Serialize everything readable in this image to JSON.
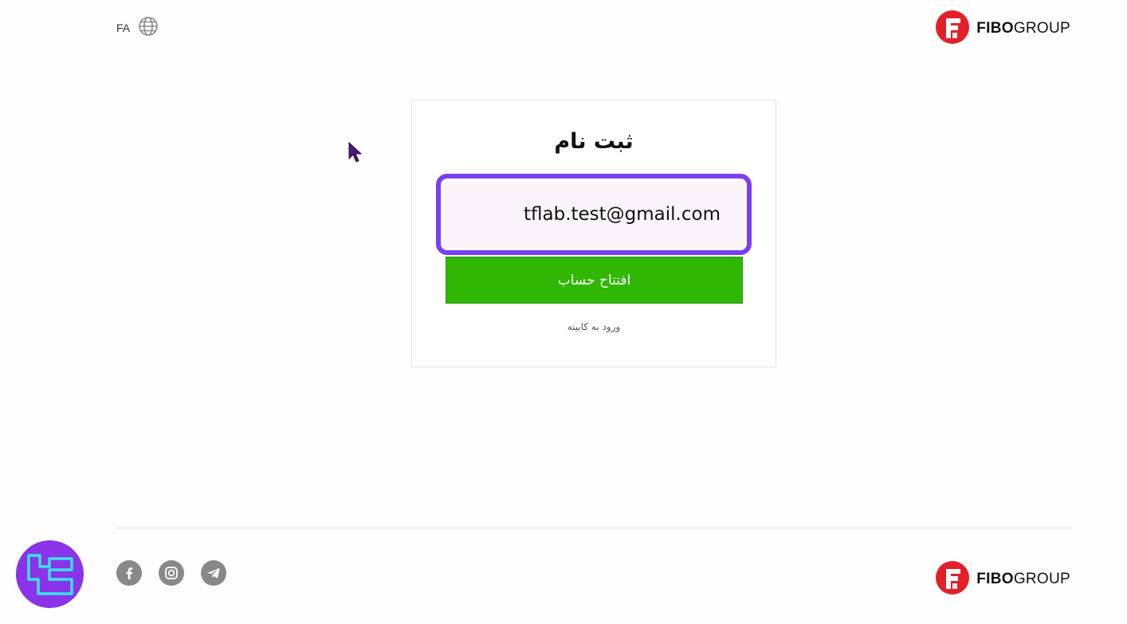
{
  "header": {
    "language_code": "FA",
    "brand": {
      "bold": "FIBO",
      "regular": "GROUP"
    }
  },
  "form": {
    "title": "ثبت نام",
    "email_value": "tflab.test@gmail.com",
    "submit_label": "افتتاح حساب",
    "login_link": "ورود به کابینه"
  },
  "footer": {
    "socials": [
      "facebook-icon",
      "instagram-icon",
      "telegram-icon"
    ],
    "brand": {
      "bold": "FIBO",
      "regular": "GROUP"
    }
  },
  "colors": {
    "accent_purple": "#7a3ff0",
    "submit_green": "#30b703",
    "brand_red": "#e3202a"
  }
}
